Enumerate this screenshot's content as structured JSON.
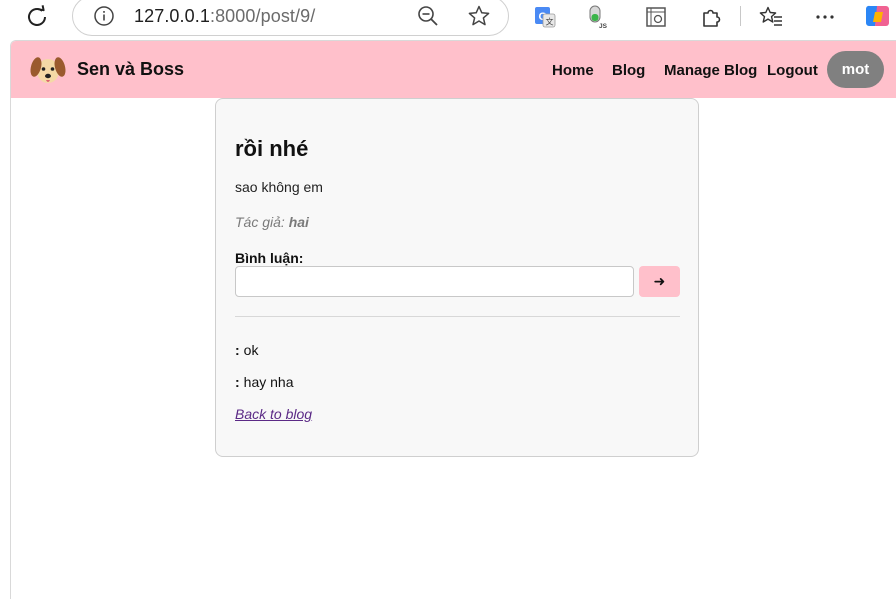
{
  "browser": {
    "url_host": "127.0.0.1",
    "url_rest": ":8000/post/9/",
    "icons": [
      "reload-icon",
      "info-icon",
      "zoom-out-icon",
      "star-icon",
      "translate-extension-icon",
      "js-extension-icon",
      "screenshot-extension-icon",
      "extensions-puzzle-icon",
      "favorites-icon",
      "more-menu-icon",
      "copilot-icon"
    ]
  },
  "site": {
    "brand": "Sen và Boss",
    "nav": {
      "home": "Home",
      "blog": "Blog",
      "manage_blog": "Manage Blog",
      "logout": "Logout"
    },
    "user": "mot",
    "accent_color": "#ffc0cb"
  },
  "post": {
    "title": "rồi nhé",
    "body": "sao không em",
    "author_label": "Tác giả:",
    "author_name": "hai",
    "comment_label": "Bình luận:",
    "comment_input_value": "",
    "send_label": "➜",
    "comments": [
      {
        "author": "",
        "text": "ok"
      },
      {
        "author": "",
        "text": "hay nha"
      }
    ],
    "back_link": "Back to blog"
  }
}
